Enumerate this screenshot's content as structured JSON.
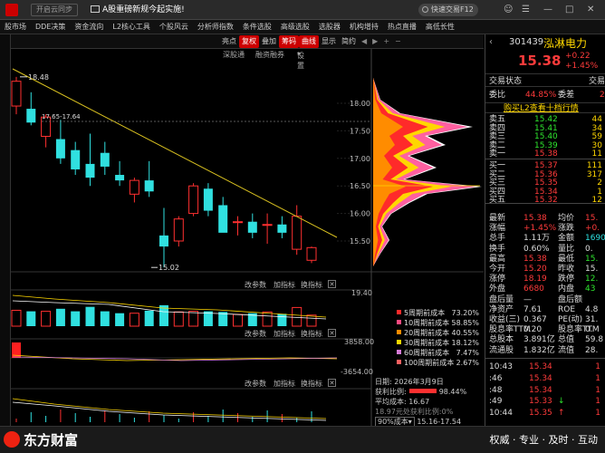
{
  "topbar": {
    "sync_label": "开启云同步",
    "news_text": "A股重磅新规今起实施!",
    "search_text": "快速交易F12",
    "win_min": "—",
    "win_max": "□",
    "win_close": "✕"
  },
  "menu": [
    "股市场",
    "DDE决策",
    "资金流向",
    "L2核心工具",
    "个股风云",
    "分析师指数",
    "条件选股",
    "高级选股",
    "选股器",
    "机构增持",
    "热点直播",
    "高低长性"
  ],
  "chart_toolbar": {
    "items": [
      "亮点",
      "复权",
      "叠加",
      "筹码",
      "曲线",
      "显示",
      "简约"
    ],
    "highlight": [
      "复权",
      "筹码",
      "曲线"
    ],
    "nav": [
      "◀",
      "▶",
      "+",
      "−"
    ]
  },
  "subbar": {
    "deep": "深股通",
    "margin": "融资融券",
    "settings": "设置"
  },
  "price_axis": [
    "18.00",
    "17.50",
    "17.00",
    "16.50",
    "16.00",
    "15.50"
  ],
  "annotations": {
    "high": "18.48",
    "low": "15.02",
    "range": "17.65-17.64"
  },
  "indicator_panels": [
    {
      "change": "改参数",
      "add": "加指标",
      "swap": "换指标",
      "close": "✕",
      "axis_top": "19.40"
    },
    {
      "change": "改参数",
      "add": "加指标",
      "swap": "换指标",
      "close": "✕",
      "axis_top": "3858.00",
      "axis_bottom": "-3654.00"
    },
    {
      "change": "改参数",
      "add": "加指标",
      "swap": "换指标",
      "close": "✕"
    }
  ],
  "chips": {
    "legend": [
      {
        "label": "5周期前成本",
        "pct": "73.20%",
        "color": "#ff2a2a"
      },
      {
        "label": "10周期前成本",
        "pct": "58.85%",
        "color": "#ff4a80"
      },
      {
        "label": "20周期前成本",
        "pct": "40.55%",
        "color": "#ff8c00"
      },
      {
        "label": "30周期前成本",
        "pct": "18.12%",
        "color": "#ffd700"
      },
      {
        "label": "60周期前成本",
        "pct": "7.47%",
        "color": "#d67bd6"
      },
      {
        "label": "100周期前成本",
        "pct": "2.67%",
        "color": "#ff6060"
      }
    ],
    "date": "日期: 2026年3月9日",
    "profit_label": "获利比例:",
    "profit_value": "98.44%",
    "avg_label": "平均成本:",
    "avg_value": "16.67",
    "zero_label": "18.97元处获利比例:",
    "zero_value": "0%",
    "cost_select": "90%成本",
    "cost_range": "15.16-17.54"
  },
  "stock": {
    "code": "301439",
    "name": "泓淋电力",
    "price": "15.38",
    "change": "+0.22",
    "change_pct": "+1.45%"
  },
  "quote_tabs": {
    "status": "交易状态",
    "right": "交易"
  },
  "weibi": {
    "label1": "委比",
    "value1": "44.85%",
    "label2": "委差",
    "value2": "2"
  },
  "l2_link": "购买L2查看十档行情",
  "orderbook": [
    {
      "label": "卖五",
      "price": "15.42",
      "vol": "44",
      "color": "green"
    },
    {
      "label": "卖四",
      "price": "15.41",
      "vol": "34",
      "color": "green"
    },
    {
      "label": "卖三",
      "price": "15.40",
      "vol": "59",
      "color": "green"
    },
    {
      "label": "卖二",
      "price": "15.39",
      "vol": "30",
      "color": "green"
    },
    {
      "label": "卖一",
      "price": "15.38",
      "vol": "11",
      "color": "red"
    },
    {
      "label": "买一",
      "price": "15.37",
      "vol": "111",
      "color": "red"
    },
    {
      "label": "买二",
      "price": "15.36",
      "vol": "317",
      "color": "red"
    },
    {
      "label": "买三",
      "price": "15.35",
      "vol": "2",
      "color": "red"
    },
    {
      "label": "买四",
      "price": "15.34",
      "vol": "1",
      "color": "red"
    },
    {
      "label": "买五",
      "price": "15.32",
      "vol": "12",
      "color": "red"
    }
  ],
  "stats": [
    {
      "l1": "最新",
      "v1": "15.38",
      "c1": "red",
      "l2": "均价",
      "v2": "15.",
      "c2": "red"
    },
    {
      "l1": "涨幅",
      "v1": "+1.45%",
      "c1": "red",
      "l2": "涨跌",
      "v2": "+0.",
      "c2": "red"
    },
    {
      "l1": "总手",
      "v1": "1.11万",
      "c1": "white",
      "l2": "金额",
      "v2": "1690",
      "c2": "cyan"
    },
    {
      "l1": "换手",
      "v1": "0.60%",
      "c1": "white",
      "l2": "量比",
      "v2": "0.",
      "c2": "white"
    },
    {
      "l1": "最高",
      "v1": "15.38",
      "c1": "red",
      "l2": "最低",
      "v2": "15.",
      "c2": "green"
    },
    {
      "l1": "今开",
      "v1": "15.20",
      "c1": "red",
      "l2": "昨收",
      "v2": "15.",
      "c2": "white"
    },
    {
      "l1": "涨停",
      "v1": "18.19",
      "c1": "red",
      "l2": "跌停",
      "v2": "12.",
      "c2": "green"
    },
    {
      "l1": "外盘",
      "v1": "6680",
      "c1": "red",
      "l2": "内盘",
      "v2": "43",
      "c2": "green"
    },
    {
      "l1": "盘后量",
      "v1": "—",
      "c1": "white",
      "l2": "盘后额",
      "v2": "",
      "c2": "white"
    },
    {
      "l1": "净资产",
      "v1": "7.61",
      "c1": "white",
      "l2": "ROE",
      "v2": "4.8",
      "c2": "white"
    },
    {
      "l1": "收益(三)",
      "v1": "0.367",
      "c1": "white",
      "l2": "PE(动)",
      "v2": "31.",
      "c2": "white"
    },
    {
      "l1": "股息率TTM",
      "v1": "0.20",
      "c1": "white",
      "l2": "股息率TTM",
      "v2": "0.",
      "c2": "white"
    },
    {
      "l1": "总股本",
      "v1": "3.891亿",
      "c1": "white",
      "l2": "总值",
      "v2": "59.8",
      "c2": "white"
    },
    {
      "l1": "流通股",
      "v1": "1.832亿",
      "c1": "white",
      "l2": "流值",
      "v2": "28.",
      "c2": "white"
    }
  ],
  "ticks": [
    {
      "time": "10:43",
      "price": "15.34",
      "vol": "1",
      "arrow": ""
    },
    {
      "time": ":46",
      "price": "15.34",
      "vol": "1",
      "arrow": ""
    },
    {
      "time": ":48",
      "price": "15.34",
      "vol": "1",
      "arrow": ""
    },
    {
      "time": ":49",
      "price": "15.33",
      "vol": "1",
      "arrow": "↓"
    },
    {
      "time": "10:44",
      "price": "15.35",
      "vol": "1",
      "arrow": "↑"
    }
  ],
  "brand": "东方财富",
  "slogan": "权威 · 专业 · 及时 · 互动",
  "candles": [
    [
      0,
      17.95,
      18.48,
      17.8,
      18.4
    ],
    [
      1,
      17.9,
      18.2,
      17.6,
      17.65
    ],
    [
      2,
      17.4,
      17.8,
      17.2,
      17.75
    ],
    [
      3,
      17.35,
      17.7,
      16.9,
      17.0
    ],
    [
      4,
      17.15,
      17.3,
      16.7,
      16.8
    ],
    [
      5,
      16.9,
      17.45,
      16.5,
      16.65
    ],
    [
      6,
      17.1,
      17.3,
      16.7,
      16.85
    ],
    [
      7,
      16.7,
      16.95,
      16.5,
      16.6
    ],
    [
      8,
      16.35,
      16.65,
      16.2,
      16.6
    ],
    [
      9,
      16.6,
      16.95,
      16.3,
      16.4
    ],
    [
      10,
      15.6,
      16.1,
      15.02,
      15.4
    ],
    [
      11,
      15.5,
      15.95,
      15.4,
      15.9
    ],
    [
      12,
      16.0,
      16.55,
      15.95,
      16.5
    ],
    [
      13,
      16.45,
      16.55,
      15.95,
      16.05
    ],
    [
      14,
      16.15,
      16.3,
      15.75,
      15.65
    ],
    [
      15,
      15.85,
      15.95,
      15.6,
      15.85
    ],
    [
      16,
      15.85,
      16.0,
      15.55,
      15.65
    ],
    [
      17,
      15.8,
      16.0,
      15.45,
      15.8
    ],
    [
      18,
      15.8,
      15.95,
      15.55,
      15.65
    ],
    [
      19,
      15.35,
      16.15,
      15.25,
      15.95
    ],
    [
      20,
      15.15,
      15.4,
      15.1,
      15.38
    ]
  ]
}
